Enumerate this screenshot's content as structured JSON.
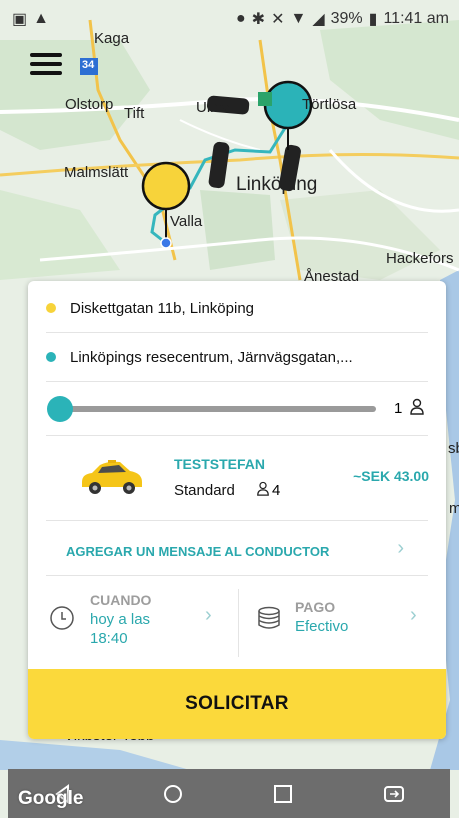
{
  "status_bar": {
    "battery": "39%",
    "time": "11:41 am"
  },
  "map": {
    "labels": [
      "Kaga",
      "34",
      "Olstorp",
      "Tift",
      "Ullevi",
      "Törtlösa",
      "Malmslätt",
      "Linköping",
      "Valla",
      "Hackefors",
      "Ånestad",
      "Vikbster Tebb",
      "sb",
      "m"
    ],
    "google": "Google"
  },
  "trip": {
    "pickup": "Diskettgatan 11b, Linköping",
    "destination": "Linköpings resecentrum, Järnvägsgatan,...",
    "passengers": "1",
    "passenger_fraction": 0
  },
  "vehicle": {
    "name": "TESTSTEFAN",
    "class": "Standard",
    "capacity": "4",
    "price": "~SEK 43.00"
  },
  "driver_message": "AGREGAR UN MENSAJE AL CONDUCTOR",
  "when": {
    "label": "CUANDO",
    "value_line1": "hoy a las",
    "value_line2": "18:40"
  },
  "payment": {
    "label": "PAGO",
    "value": "Efectivo"
  },
  "request_button": "SOLICITAR",
  "colors": {
    "yellow": "#fbd93b",
    "teal": "#2bb3b8",
    "pickup_dot": "#f7d33a",
    "dest_dot": "#2bb3b8"
  },
  "icons": [
    "menu-icon",
    "clock-icon",
    "wallet-icon",
    "person-icon",
    "taxi-icon",
    "chevron-right-icon"
  ]
}
